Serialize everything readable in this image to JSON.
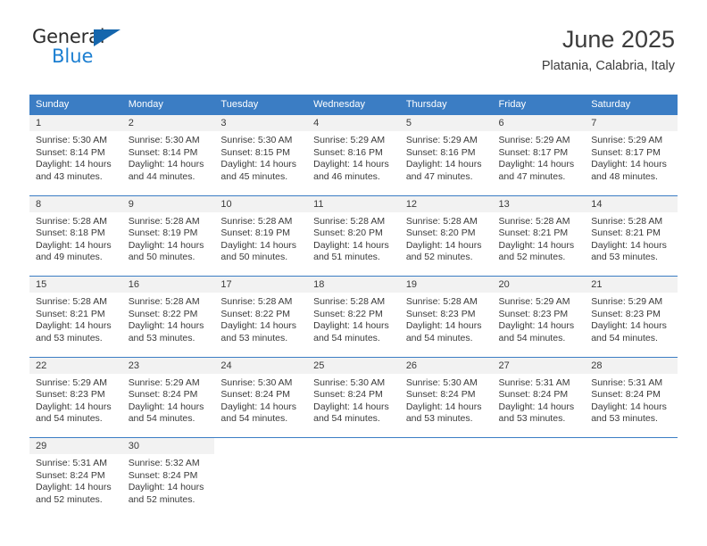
{
  "brand": {
    "name_part1": "General",
    "name_part2": "Blue",
    "triangle_color": "#1566ad",
    "blue_color": "#1c7fd1"
  },
  "header": {
    "title": "June 2025",
    "subtitle": "Platania, Calabria, Italy"
  },
  "theme": {
    "header_bg": "#3b7dc4",
    "daynum_bg": "#f2f2f2",
    "text_color": "#3a3a3a"
  },
  "weekday_headers": [
    "Sunday",
    "Monday",
    "Tuesday",
    "Wednesday",
    "Thursday",
    "Friday",
    "Saturday"
  ],
  "weeks": [
    {
      "days": [
        {
          "num": "1",
          "sunrise": "Sunrise: 5:30 AM",
          "sunset": "Sunset: 8:14 PM",
          "daylight1": "Daylight: 14 hours",
          "daylight2": "and 43 minutes."
        },
        {
          "num": "2",
          "sunrise": "Sunrise: 5:30 AM",
          "sunset": "Sunset: 8:14 PM",
          "daylight1": "Daylight: 14 hours",
          "daylight2": "and 44 minutes."
        },
        {
          "num": "3",
          "sunrise": "Sunrise: 5:30 AM",
          "sunset": "Sunset: 8:15 PM",
          "daylight1": "Daylight: 14 hours",
          "daylight2": "and 45 minutes."
        },
        {
          "num": "4",
          "sunrise": "Sunrise: 5:29 AM",
          "sunset": "Sunset: 8:16 PM",
          "daylight1": "Daylight: 14 hours",
          "daylight2": "and 46 minutes."
        },
        {
          "num": "5",
          "sunrise": "Sunrise: 5:29 AM",
          "sunset": "Sunset: 8:16 PM",
          "daylight1": "Daylight: 14 hours",
          "daylight2": "and 47 minutes."
        },
        {
          "num": "6",
          "sunrise": "Sunrise: 5:29 AM",
          "sunset": "Sunset: 8:17 PM",
          "daylight1": "Daylight: 14 hours",
          "daylight2": "and 47 minutes."
        },
        {
          "num": "7",
          "sunrise": "Sunrise: 5:29 AM",
          "sunset": "Sunset: 8:17 PM",
          "daylight1": "Daylight: 14 hours",
          "daylight2": "and 48 minutes."
        }
      ]
    },
    {
      "days": [
        {
          "num": "8",
          "sunrise": "Sunrise: 5:28 AM",
          "sunset": "Sunset: 8:18 PM",
          "daylight1": "Daylight: 14 hours",
          "daylight2": "and 49 minutes."
        },
        {
          "num": "9",
          "sunrise": "Sunrise: 5:28 AM",
          "sunset": "Sunset: 8:19 PM",
          "daylight1": "Daylight: 14 hours",
          "daylight2": "and 50 minutes."
        },
        {
          "num": "10",
          "sunrise": "Sunrise: 5:28 AM",
          "sunset": "Sunset: 8:19 PM",
          "daylight1": "Daylight: 14 hours",
          "daylight2": "and 50 minutes."
        },
        {
          "num": "11",
          "sunrise": "Sunrise: 5:28 AM",
          "sunset": "Sunset: 8:20 PM",
          "daylight1": "Daylight: 14 hours",
          "daylight2": "and 51 minutes."
        },
        {
          "num": "12",
          "sunrise": "Sunrise: 5:28 AM",
          "sunset": "Sunset: 8:20 PM",
          "daylight1": "Daylight: 14 hours",
          "daylight2": "and 52 minutes."
        },
        {
          "num": "13",
          "sunrise": "Sunrise: 5:28 AM",
          "sunset": "Sunset: 8:21 PM",
          "daylight1": "Daylight: 14 hours",
          "daylight2": "and 52 minutes."
        },
        {
          "num": "14",
          "sunrise": "Sunrise: 5:28 AM",
          "sunset": "Sunset: 8:21 PM",
          "daylight1": "Daylight: 14 hours",
          "daylight2": "and 53 minutes."
        }
      ]
    },
    {
      "days": [
        {
          "num": "15",
          "sunrise": "Sunrise: 5:28 AM",
          "sunset": "Sunset: 8:21 PM",
          "daylight1": "Daylight: 14 hours",
          "daylight2": "and 53 minutes."
        },
        {
          "num": "16",
          "sunrise": "Sunrise: 5:28 AM",
          "sunset": "Sunset: 8:22 PM",
          "daylight1": "Daylight: 14 hours",
          "daylight2": "and 53 minutes."
        },
        {
          "num": "17",
          "sunrise": "Sunrise: 5:28 AM",
          "sunset": "Sunset: 8:22 PM",
          "daylight1": "Daylight: 14 hours",
          "daylight2": "and 53 minutes."
        },
        {
          "num": "18",
          "sunrise": "Sunrise: 5:28 AM",
          "sunset": "Sunset: 8:22 PM",
          "daylight1": "Daylight: 14 hours",
          "daylight2": "and 54 minutes."
        },
        {
          "num": "19",
          "sunrise": "Sunrise: 5:28 AM",
          "sunset": "Sunset: 8:23 PM",
          "daylight1": "Daylight: 14 hours",
          "daylight2": "and 54 minutes."
        },
        {
          "num": "20",
          "sunrise": "Sunrise: 5:29 AM",
          "sunset": "Sunset: 8:23 PM",
          "daylight1": "Daylight: 14 hours",
          "daylight2": "and 54 minutes."
        },
        {
          "num": "21",
          "sunrise": "Sunrise: 5:29 AM",
          "sunset": "Sunset: 8:23 PM",
          "daylight1": "Daylight: 14 hours",
          "daylight2": "and 54 minutes."
        }
      ]
    },
    {
      "days": [
        {
          "num": "22",
          "sunrise": "Sunrise: 5:29 AM",
          "sunset": "Sunset: 8:23 PM",
          "daylight1": "Daylight: 14 hours",
          "daylight2": "and 54 minutes."
        },
        {
          "num": "23",
          "sunrise": "Sunrise: 5:29 AM",
          "sunset": "Sunset: 8:24 PM",
          "daylight1": "Daylight: 14 hours",
          "daylight2": "and 54 minutes."
        },
        {
          "num": "24",
          "sunrise": "Sunrise: 5:30 AM",
          "sunset": "Sunset: 8:24 PM",
          "daylight1": "Daylight: 14 hours",
          "daylight2": "and 54 minutes."
        },
        {
          "num": "25",
          "sunrise": "Sunrise: 5:30 AM",
          "sunset": "Sunset: 8:24 PM",
          "daylight1": "Daylight: 14 hours",
          "daylight2": "and 54 minutes."
        },
        {
          "num": "26",
          "sunrise": "Sunrise: 5:30 AM",
          "sunset": "Sunset: 8:24 PM",
          "daylight1": "Daylight: 14 hours",
          "daylight2": "and 53 minutes."
        },
        {
          "num": "27",
          "sunrise": "Sunrise: 5:31 AM",
          "sunset": "Sunset: 8:24 PM",
          "daylight1": "Daylight: 14 hours",
          "daylight2": "and 53 minutes."
        },
        {
          "num": "28",
          "sunrise": "Sunrise: 5:31 AM",
          "sunset": "Sunset: 8:24 PM",
          "daylight1": "Daylight: 14 hours",
          "daylight2": "and 53 minutes."
        }
      ]
    },
    {
      "days": [
        {
          "num": "29",
          "sunrise": "Sunrise: 5:31 AM",
          "sunset": "Sunset: 8:24 PM",
          "daylight1": "Daylight: 14 hours",
          "daylight2": "and 52 minutes."
        },
        {
          "num": "30",
          "sunrise": "Sunrise: 5:32 AM",
          "sunset": "Sunset: 8:24 PM",
          "daylight1": "Daylight: 14 hours",
          "daylight2": "and 52 minutes."
        },
        {
          "num": "",
          "sunrise": "",
          "sunset": "",
          "daylight1": "",
          "daylight2": ""
        },
        {
          "num": "",
          "sunrise": "",
          "sunset": "",
          "daylight1": "",
          "daylight2": ""
        },
        {
          "num": "",
          "sunrise": "",
          "sunset": "",
          "daylight1": "",
          "daylight2": ""
        },
        {
          "num": "",
          "sunrise": "",
          "sunset": "",
          "daylight1": "",
          "daylight2": ""
        },
        {
          "num": "",
          "sunrise": "",
          "sunset": "",
          "daylight1": "",
          "daylight2": ""
        }
      ]
    }
  ]
}
